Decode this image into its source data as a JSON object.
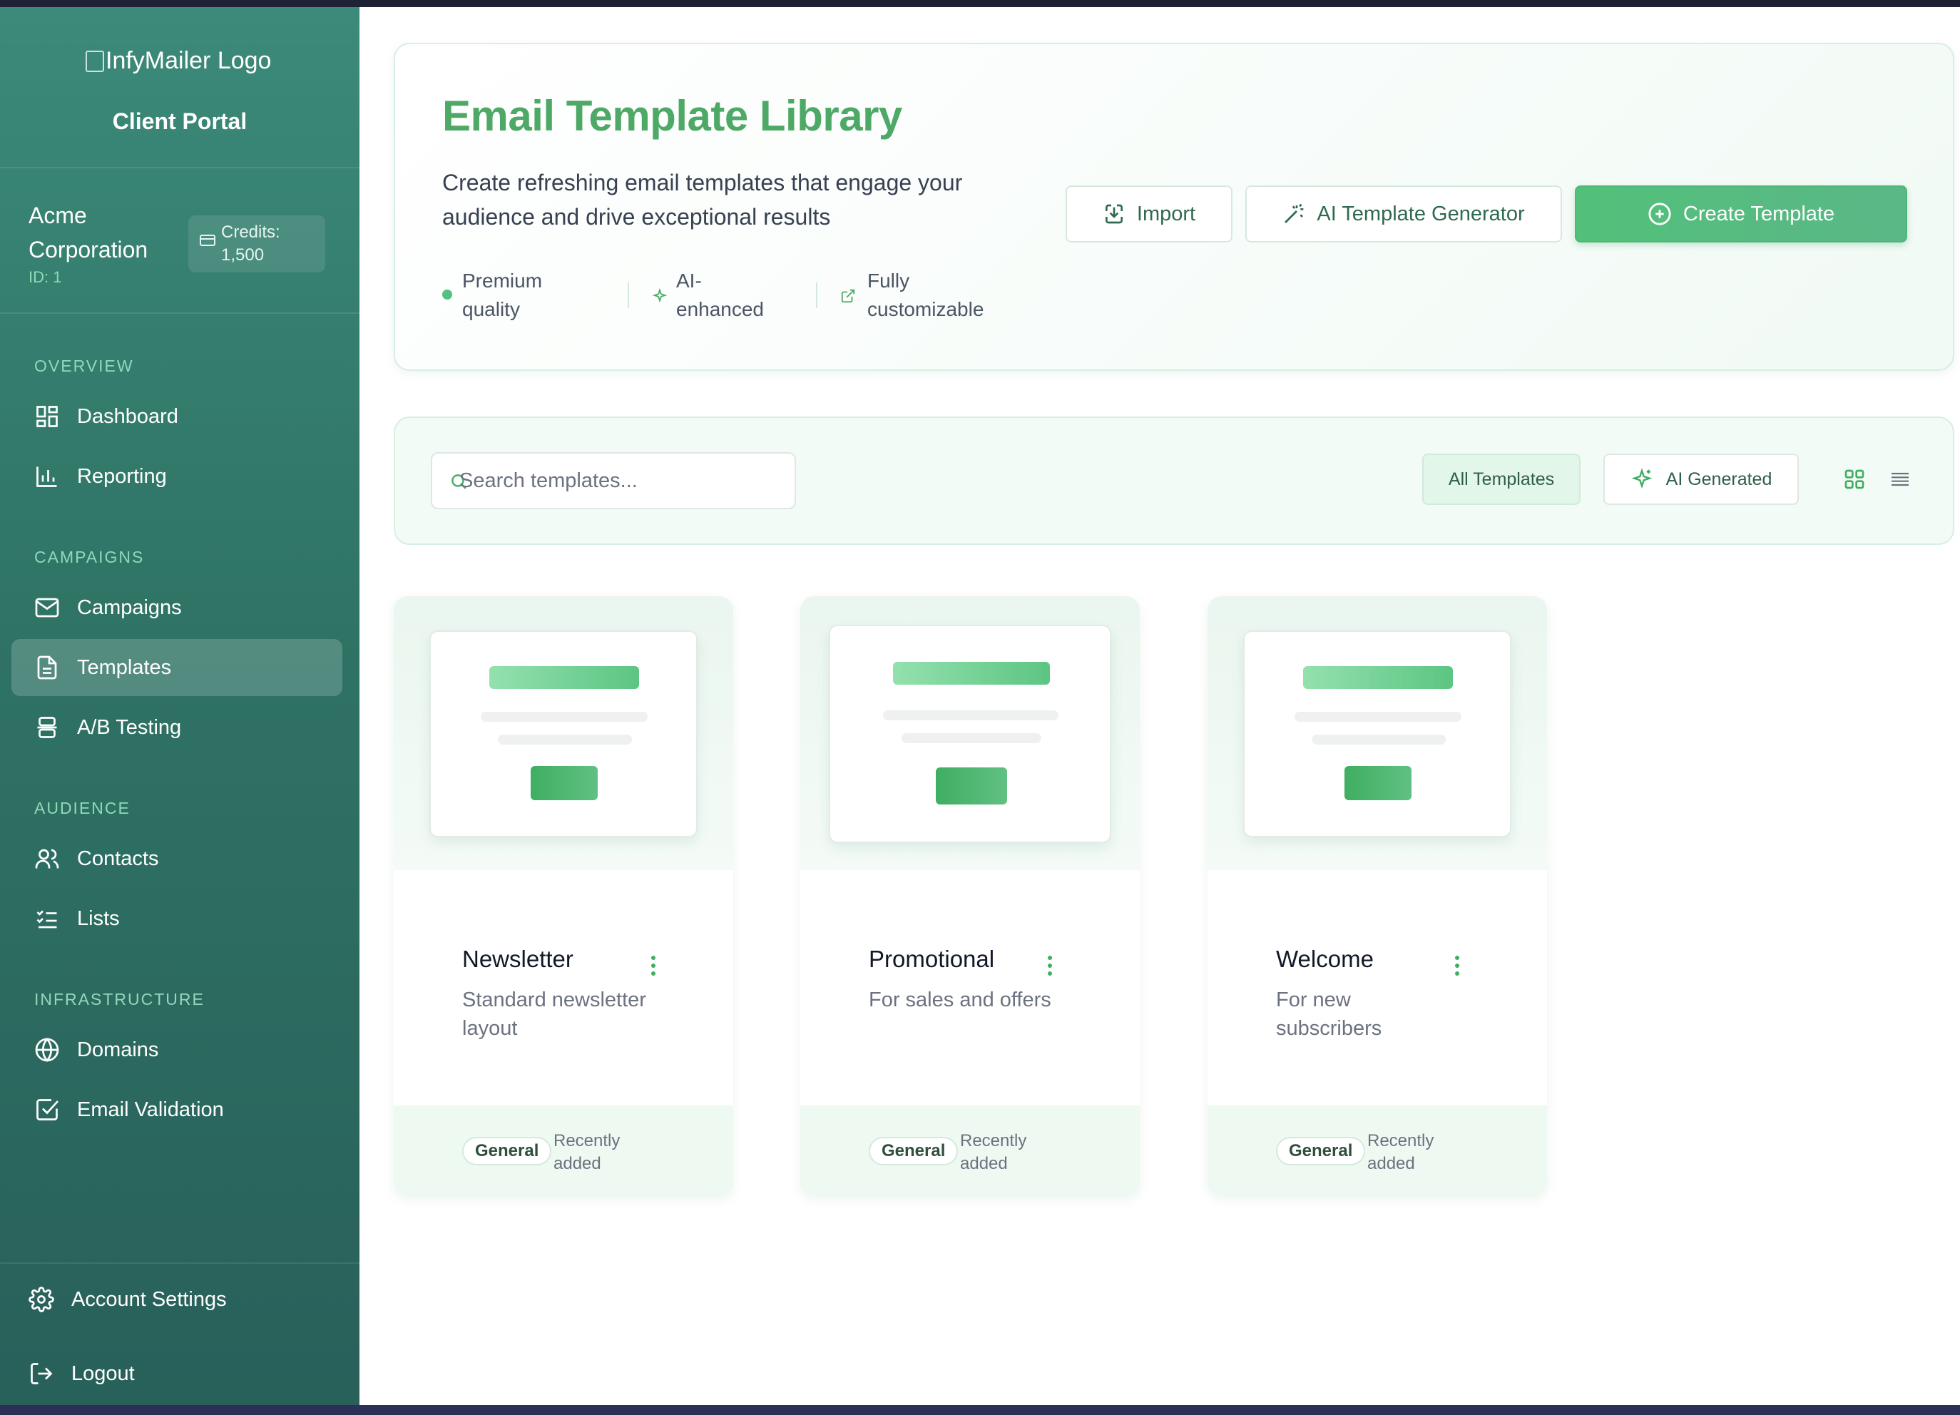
{
  "sidebar": {
    "logo_alt": "InfyMailer Logo",
    "portal_label": "Client Portal",
    "org": {
      "name": "Acme Corporation",
      "id": "ID: 1",
      "credits": "Credits: 1,500"
    },
    "sections": [
      {
        "title": "OVERVIEW",
        "items": [
          {
            "label": "Dashboard",
            "icon": "dashboard-icon"
          },
          {
            "label": "Reporting",
            "icon": "bar-chart-icon"
          }
        ]
      },
      {
        "title": "CAMPAIGNS",
        "items": [
          {
            "label": "Campaigns",
            "icon": "mail-icon"
          },
          {
            "label": "Templates",
            "icon": "file-text-icon",
            "active": true
          },
          {
            "label": "A/B Testing",
            "icon": "split-icon"
          }
        ]
      },
      {
        "title": "AUDIENCE",
        "items": [
          {
            "label": "Contacts",
            "icon": "users-icon"
          },
          {
            "label": "Lists",
            "icon": "list-checks-icon"
          }
        ]
      },
      {
        "title": "INFRASTRUCTURE",
        "items": [
          {
            "label": "Domains",
            "icon": "globe-icon"
          },
          {
            "label": "Email Validation",
            "icon": "check-square-icon"
          }
        ]
      }
    ],
    "footer": [
      {
        "label": "Account Settings",
        "icon": "gear-icon"
      },
      {
        "label": "Logout",
        "icon": "logout-icon"
      }
    ]
  },
  "hero": {
    "title": "Email Template Library",
    "description": "Create refreshing email templates that engage your audience and drive exceptional results",
    "features": [
      "Premium quality",
      "AI-enhanced",
      "Fully customizable"
    ],
    "buttons": {
      "import": "Import",
      "ai_generator": "AI Template Generator",
      "create": "Create Template"
    }
  },
  "toolbar": {
    "search_placeholder": "Search templates...",
    "filters": {
      "all": "All Templates",
      "ai": "AI Generated"
    }
  },
  "templates": [
    {
      "name": "Newsletter",
      "description": "Standard newsletter layout",
      "category": "General",
      "added": "Recently added"
    },
    {
      "name": "Promotional",
      "description": "For sales and offers",
      "category": "General",
      "added": "Recently added"
    },
    {
      "name": "Welcome",
      "description": "For new subscribers",
      "category": "General",
      "added": "Recently added"
    }
  ],
  "colors": {
    "accent": "#4ea866",
    "sidebar": "#2f7365",
    "primary_button": "#52c07a"
  }
}
